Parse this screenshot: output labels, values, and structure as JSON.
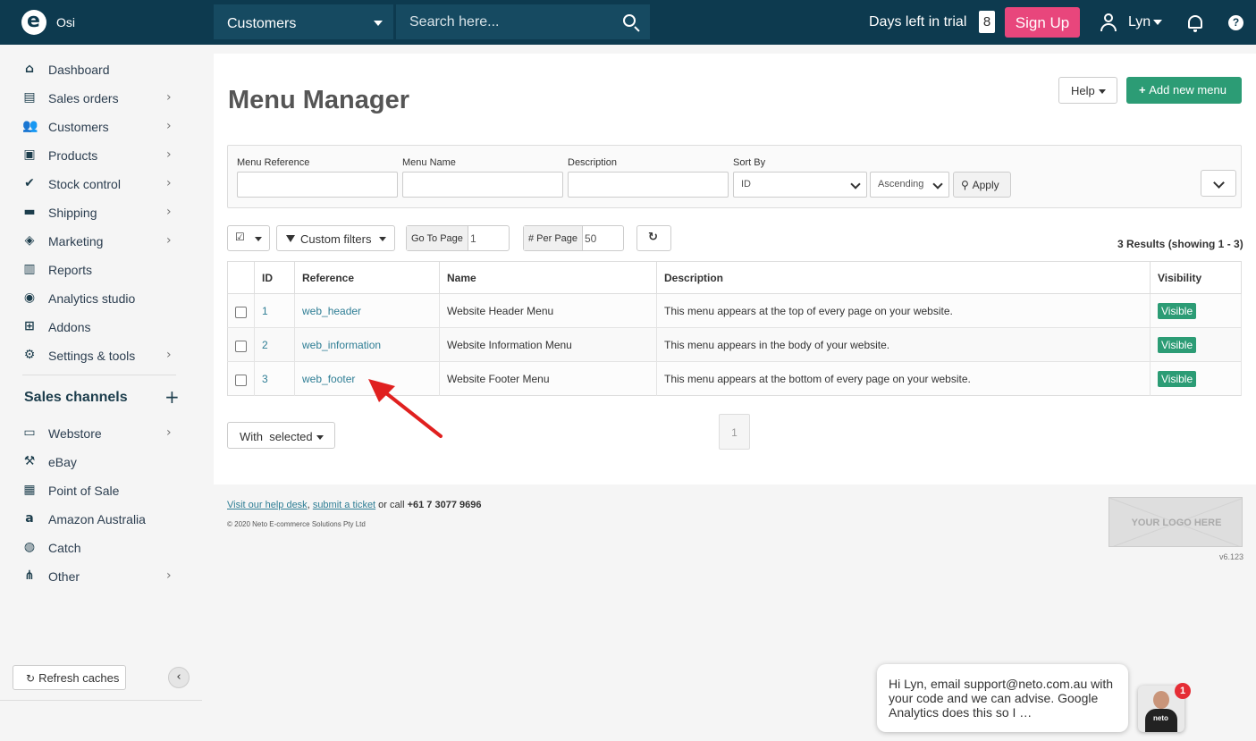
{
  "app": {
    "store_name": "Osi"
  },
  "topbar": {
    "nav_select": "Customers",
    "search_placeholder": "Search here...",
    "trial_label": "Days left in trial",
    "trial_days": "8",
    "signup_label": "Sign Up",
    "user_name": "Lyn"
  },
  "sidebar": {
    "items": [
      {
        "label": "Dashboard",
        "icon": "home-icon",
        "chevron": false
      },
      {
        "label": "Sales orders",
        "icon": "document-icon",
        "chevron": true
      },
      {
        "label": "Customers",
        "icon": "people-icon",
        "chevron": true
      },
      {
        "label": "Products",
        "icon": "gift-icon",
        "chevron": true
      },
      {
        "label": "Stock control",
        "icon": "clipboard-check-icon",
        "chevron": true
      },
      {
        "label": "Shipping",
        "icon": "truck-icon",
        "chevron": true
      },
      {
        "label": "Marketing",
        "icon": "tag-icon",
        "chevron": true
      },
      {
        "label": "Reports",
        "icon": "bar-chart-icon",
        "chevron": false
      },
      {
        "label": "Analytics studio",
        "icon": "analytics-icon",
        "chevron": false
      },
      {
        "label": "Addons",
        "icon": "plus-square-icon",
        "chevron": false
      },
      {
        "label": "Settings & tools",
        "icon": "gear-icon",
        "chevron": true
      }
    ],
    "channels_title": "Sales channels",
    "channels": [
      {
        "label": "Webstore",
        "icon": "browser-icon",
        "chevron": true
      },
      {
        "label": "eBay",
        "icon": "gavel-icon",
        "chevron": false
      },
      {
        "label": "Point of Sale",
        "icon": "register-icon",
        "chevron": false
      },
      {
        "label": "Amazon Australia",
        "icon": "amazon-icon",
        "chevron": false
      },
      {
        "label": "Catch",
        "icon": "catch-icon",
        "chevron": false
      },
      {
        "label": "Other",
        "icon": "network-icon",
        "chevron": true
      }
    ],
    "refresh_label": "Refresh caches"
  },
  "page": {
    "title": "Menu Manager",
    "help_label": "Help",
    "add_label": "Add new menu"
  },
  "filters": {
    "menu_reference_label": "Menu Reference",
    "menu_name_label": "Menu Name",
    "description_label": "Description",
    "sort_by_label": "Sort By",
    "sort_by_value": "ID",
    "order_value": "Ascending",
    "apply_label": "Apply"
  },
  "toolbar": {
    "custom_filters_label": "Custom filters",
    "goto_page_label": "Go To Page",
    "goto_page_value": "1",
    "per_page_label": "# Per Page",
    "per_page_value": "50",
    "results_text": "3 Results (showing 1 - 3)"
  },
  "table": {
    "columns": [
      "ID",
      "Reference",
      "Name",
      "Description",
      "Visibility"
    ],
    "rows": [
      {
        "id": "1",
        "reference": "web_header",
        "name": "Website Header Menu",
        "description": "This menu appears at the top of every page on your website.",
        "visibility": "Visible"
      },
      {
        "id": "2",
        "reference": "web_information",
        "name": "Website Information Menu",
        "description": "This menu appears in the body of your website.",
        "visibility": "Visible"
      },
      {
        "id": "3",
        "reference": "web_footer",
        "name": "Website Footer Menu",
        "description": "This menu appears at the bottom of every page on your website.",
        "visibility": "Visible"
      }
    ]
  },
  "bulk": {
    "with_selected_label": "With  selected"
  },
  "pagination": {
    "current_page": "1"
  },
  "footer": {
    "help_desk": "Visit our help desk",
    "submit_ticket": "submit a ticket",
    "or_call": " or call ",
    "phone": "+61 7 3077 9696",
    "copyright": "© 2020 Neto E-commerce Solutions Pty Ltd",
    "logo_placeholder": "YOUR LOGO HERE",
    "version": "v6.123"
  },
  "chat": {
    "message": "Hi Lyn, email support@neto.com.au with your code and we can advise. Google Analytics does this so I …",
    "unread_count": "1",
    "shirt_text": "neto"
  },
  "colors": {
    "topbar": "#0d3a4f",
    "signup": "#e8467c",
    "primary_green": "#2c9c75",
    "link": "#2f7e95",
    "annotation_arrow": "#e0201f"
  }
}
